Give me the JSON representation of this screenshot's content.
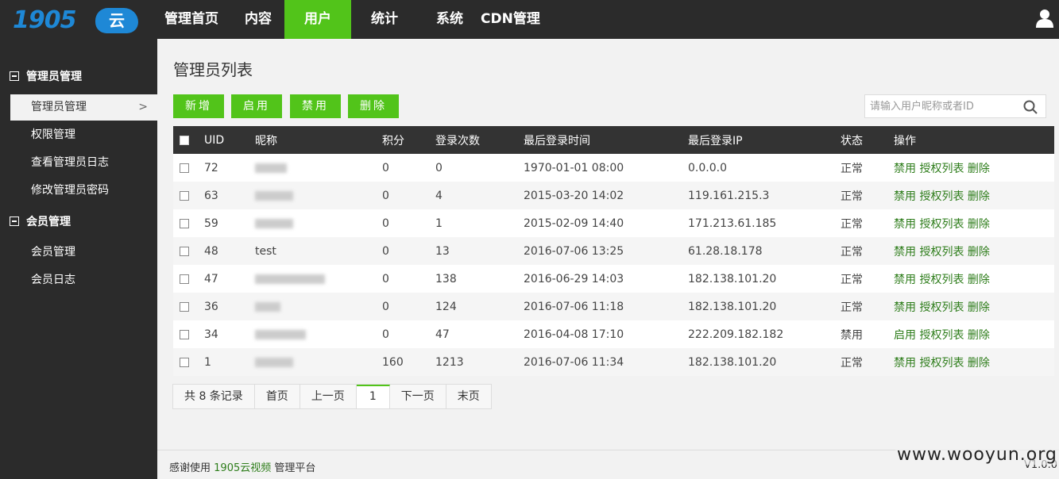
{
  "logo": {
    "text": "1905",
    "cloud": "云"
  },
  "nav": [
    {
      "label": "管理首页"
    },
    {
      "label": "内容"
    },
    {
      "label": "用户",
      "active": true
    },
    {
      "label": "统计"
    },
    {
      "label": "系统"
    },
    {
      "label": "CDN管理"
    }
  ],
  "sidebar": {
    "groups": [
      {
        "title": "管理员管理",
        "items": [
          "管理员管理",
          "权限管理",
          "查看管理员日志",
          "修改管理员密码"
        ]
      },
      {
        "title": "会员管理",
        "items": [
          "会员管理",
          "会员日志"
        ]
      }
    ],
    "active_chevron": ">"
  },
  "main": {
    "title": "管理员列表",
    "buttons": [
      "新增",
      "启用",
      "禁用",
      "删除"
    ],
    "search_placeholder": "请输入用户昵称或者ID"
  },
  "table": {
    "headers": [
      "UID",
      "昵称",
      "积分",
      "登录次数",
      "最后登录时间",
      "最后登录IP",
      "状态",
      "操作"
    ],
    "rows": [
      {
        "uid": "72",
        "nickname": "",
        "points": "0",
        "logins": "0",
        "last_time": "1970-01-01 08:00",
        "last_ip": "0.0.0.0",
        "status": "正常",
        "toggle": "禁用",
        "auth": "授权列表",
        "del": "删除"
      },
      {
        "uid": "63",
        "nickname": "",
        "points": "0",
        "logins": "4",
        "last_time": "2015-03-20 14:02",
        "last_ip": "119.161.215.3",
        "status": "正常",
        "toggle": "禁用",
        "auth": "授权列表",
        "del": "删除"
      },
      {
        "uid": "59",
        "nickname": "",
        "points": "0",
        "logins": "1",
        "last_time": "2015-02-09 14:40",
        "last_ip": "171.213.61.185",
        "status": "正常",
        "toggle": "禁用",
        "auth": "授权列表",
        "del": "删除"
      },
      {
        "uid": "48",
        "nickname": "test",
        "points": "0",
        "logins": "13",
        "last_time": "2016-07-06 13:25",
        "last_ip": "61.28.18.178",
        "status": "正常",
        "toggle": "禁用",
        "auth": "授权列表",
        "del": "删除"
      },
      {
        "uid": "47",
        "nickname": "",
        "points": "0",
        "logins": "138",
        "last_time": "2016-06-29 14:03",
        "last_ip": "182.138.101.20",
        "status": "正常",
        "toggle": "禁用",
        "auth": "授权列表",
        "del": "删除"
      },
      {
        "uid": "36",
        "nickname": "",
        "points": "0",
        "logins": "124",
        "last_time": "2016-07-06 11:18",
        "last_ip": "182.138.101.20",
        "status": "正常",
        "toggle": "禁用",
        "auth": "授权列表",
        "del": "删除"
      },
      {
        "uid": "34",
        "nickname": "",
        "points": "0",
        "logins": "47",
        "last_time": "2016-04-08 17:10",
        "last_ip": "222.209.182.182",
        "status": "禁用",
        "toggle": "启用",
        "auth": "授权列表",
        "del": "删除"
      },
      {
        "uid": "1",
        "nickname": "",
        "points": "160",
        "logins": "1213",
        "last_time": "2016-07-06 11:34",
        "last_ip": "182.138.101.20",
        "status": "正常",
        "toggle": "禁用",
        "auth": "授权列表",
        "del": "删除"
      }
    ]
  },
  "pagination": {
    "info": "共 8 条记录",
    "first": "首页",
    "prev": "上一页",
    "current": "1",
    "next": "下一页",
    "last": "末页"
  },
  "footer": {
    "prefix": "感谢使用",
    "brand": "1905云视频",
    "suffix": "管理平台",
    "version": "V1.0.0"
  },
  "watermark": "www.wooyun.org",
  "colors": {
    "accent": "#52c41a",
    "topbar": "#2b2b2b",
    "link": "#2e7d1b",
    "logo": "#1e88d6"
  }
}
